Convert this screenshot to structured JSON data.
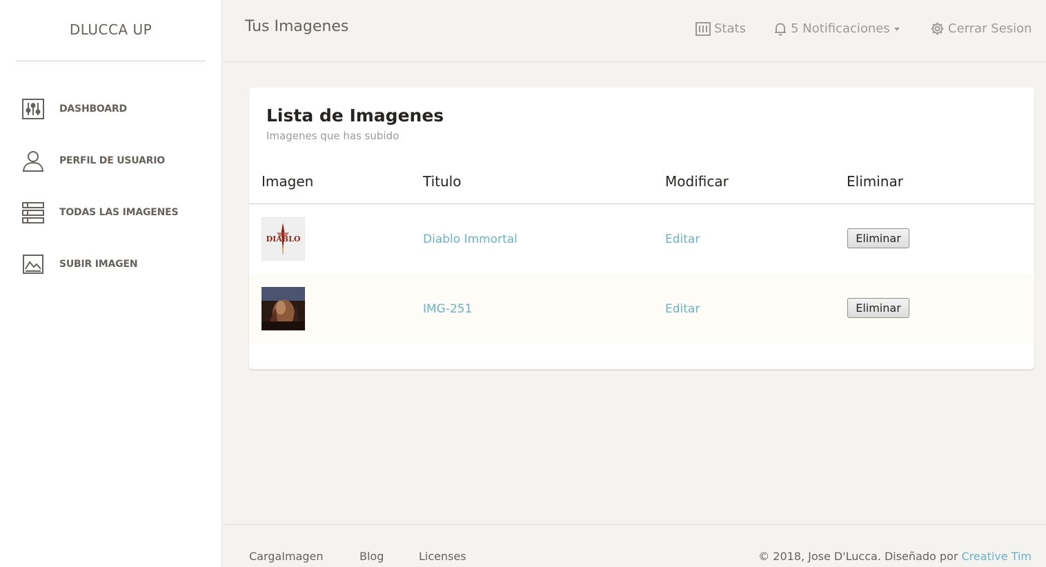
{
  "sidebar": {
    "brand": "DLUCCA UP",
    "items": [
      {
        "label": "DASHBOARD",
        "icon": "sliders-icon"
      },
      {
        "label": "PERFIL DE USUARIO",
        "icon": "user-icon"
      },
      {
        "label": "TODAS LAS IMAGENES",
        "icon": "list-icon"
      },
      {
        "label": "SUBIR IMAGEN",
        "icon": "image-icon"
      }
    ]
  },
  "header": {
    "title": "Tus Imagenes",
    "stats_label": "Stats",
    "notifications_label": "5 Notificaciones",
    "logout_label": "Cerrar Sesion"
  },
  "card": {
    "title": "Lista de Imagenes",
    "subtitle": "Imagenes que has subido",
    "columns": [
      "Imagen",
      "Titulo",
      "Modificar",
      "Eliminar"
    ],
    "rows": [
      {
        "image": "diablo-logo-thumbnail",
        "title": "Diablo Immortal",
        "edit": "Editar",
        "delete": "Eliminar"
      },
      {
        "image": "photo-thumbnail",
        "title": "IMG-251",
        "edit": "Editar",
        "delete": "Eliminar"
      }
    ]
  },
  "footer": {
    "links": [
      "CargaImagen",
      "Blog",
      "Licenses"
    ],
    "copyright_prefix": "© 2018, Jose D'Lucca. Diseñado por ",
    "copyright_author": "Creative Tim"
  },
  "colors": {
    "background": "#f4f3ef",
    "link": "#68b3c8",
    "text": "#66615b"
  }
}
